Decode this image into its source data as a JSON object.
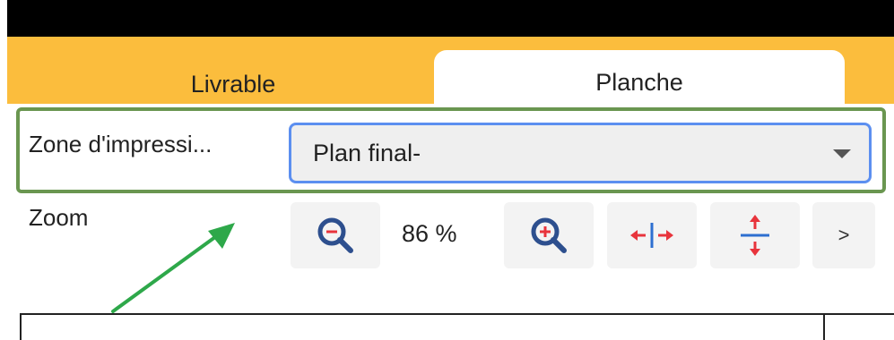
{
  "tabs": [
    {
      "label": "Livrable",
      "active": false
    },
    {
      "label": "Planche",
      "active": true
    }
  ],
  "print_zone": {
    "label": "Zone d'impressi...",
    "selected": "Plan final-"
  },
  "zoom": {
    "label": "Zoom",
    "value": "86 %",
    "more_label": ">"
  },
  "icons": [
    "zoom-out-icon",
    "zoom-in-icon",
    "fit-width-icon",
    "fit-height-icon",
    "chevron-down-icon"
  ],
  "colors": {
    "tab_bar": "#fbbd3d",
    "highlight_frame": "#6a9650",
    "select_border": "#5c8ff0",
    "icon_blue": "#2d4f8e",
    "icon_red": "#e8343c",
    "annotation_arrow": "#2ea84a"
  }
}
